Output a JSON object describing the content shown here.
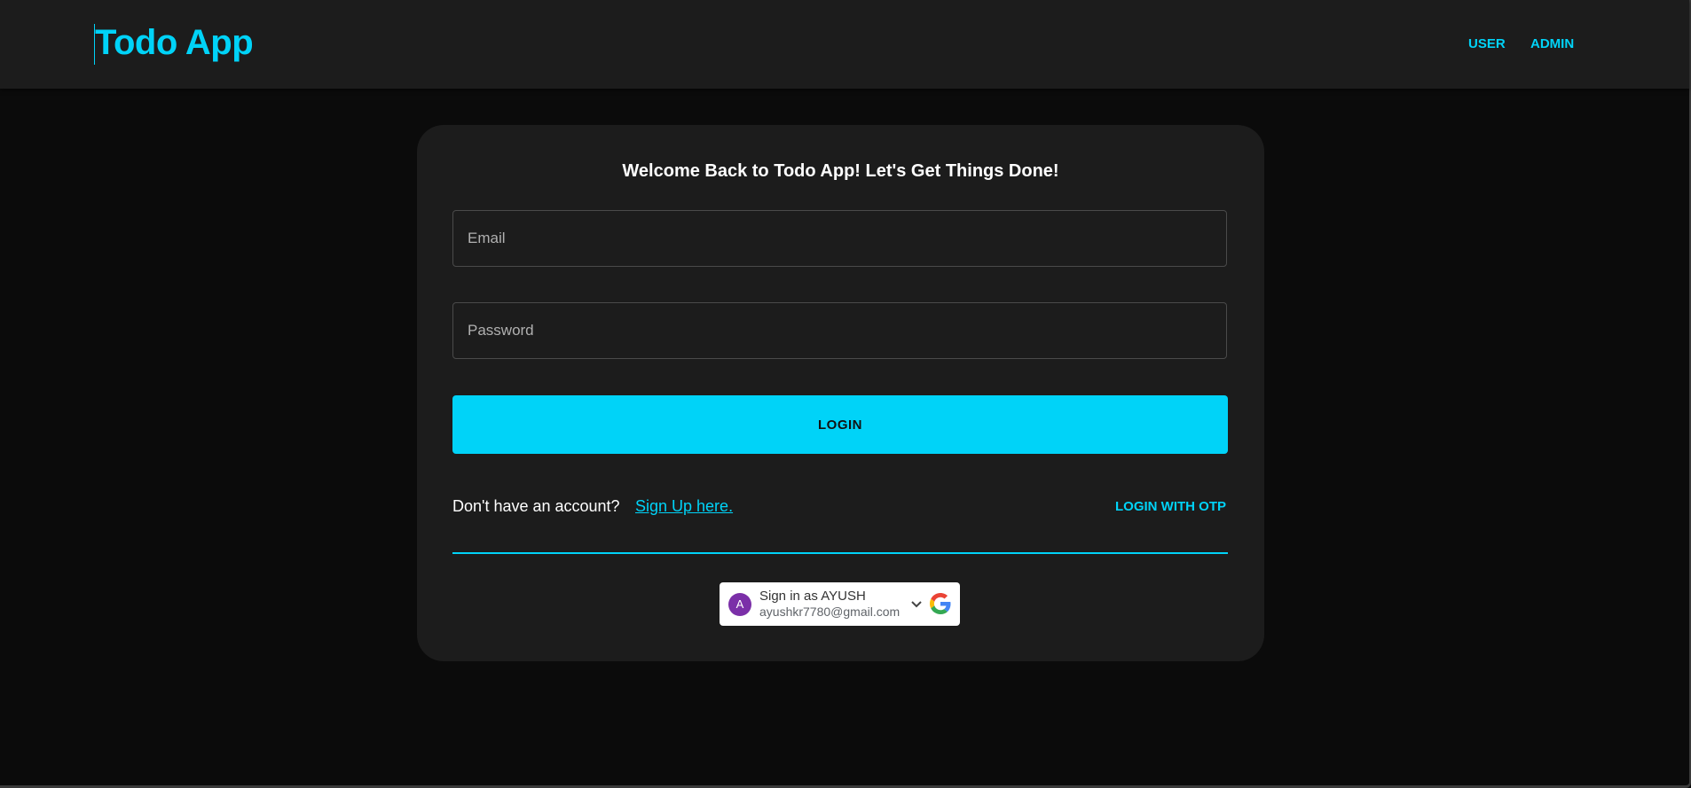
{
  "header": {
    "title": "Todo App",
    "nav": [
      "USER",
      "ADMIN"
    ]
  },
  "login_card": {
    "heading": "Welcome Back to Todo App! Let's Get Things Done!",
    "email_placeholder": "Email",
    "password_placeholder": "Password",
    "login_label": "LOGIN",
    "no_account_text": "Don't have an account?",
    "signup_link": "Sign Up here.",
    "otp_label": "LOGIN WITH OTP"
  },
  "google_signin": {
    "avatar_letter": "A",
    "name_line": "Sign in as AYUSH",
    "email": "ayushkr7780@gmail.com",
    "chevron_icon": "chevron-down-icon",
    "logo_icon": "google-logo-icon"
  },
  "colors": {
    "accent": "#00d3f8",
    "background": "#0b0b0b",
    "surface": "#1c1c1c",
    "avatar": "#7b2fa8"
  }
}
